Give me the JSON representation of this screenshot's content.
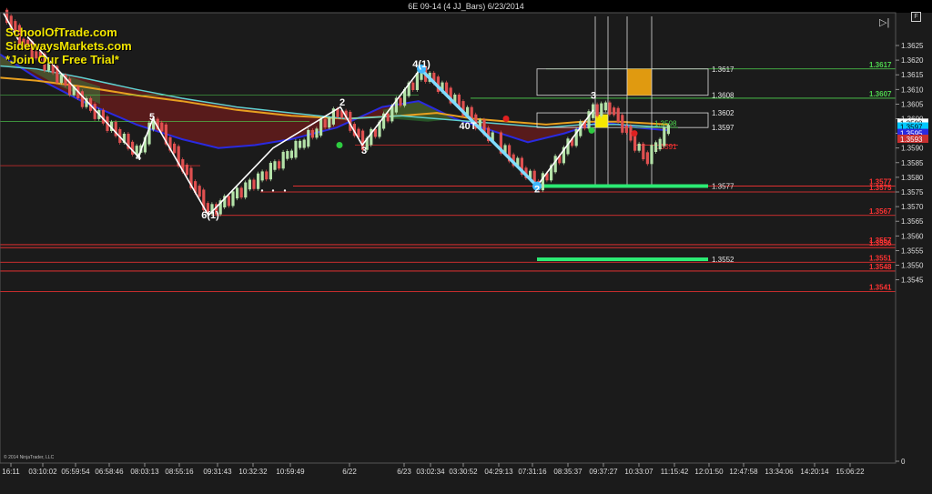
{
  "window": {
    "title": "6E 09-14 (4 JJ_Bars)  6/23/2014",
    "copyright": "© 2014 NinjaTrader, LLC"
  },
  "watermark": {
    "lines": [
      "SchoolOfTrade.com",
      "SidewaysMarkets.com",
      "*Join Our Free Trial*"
    ],
    "color": "#f2e600"
  },
  "icons": {
    "play": "play-end-icon",
    "settings": "f-settings-icon"
  },
  "colors": {
    "background": "#1b1b1b",
    "up_bar": "#b4e2a8",
    "down_bar": "#e05050",
    "zigzag": "#ffffff",
    "leg_highlight": "#7fdcff",
    "support_line": "#2bea73",
    "resistance_line": "#ff3333",
    "target_line": "#4fd64f",
    "orange_box": "#e09a10",
    "yellow_box": "#f5e800"
  },
  "chart_data": {
    "type": "candlestick",
    "symbol": "6E 09-14",
    "bar_type": "4 JJ_Bars",
    "date": "6/23/2014",
    "y_axis": {
      "range": [
        1.3538,
        1.3628
      ],
      "ticks": [
        "1.3625",
        "1.3620",
        "1.3615",
        "1.3610",
        "1.3605",
        "1.3600",
        "1.3595",
        "1.3590",
        "1.3585",
        "1.3580",
        "1.3575",
        "1.3570",
        "1.3565",
        "1.3560",
        "1.3555",
        "1.3550",
        "1.3545",
        "0"
      ],
      "last_price": "1.3598",
      "price_flags": [
        {
          "text": "1.3598",
          "bg": "#ffffff",
          "fg": "#000000"
        },
        {
          "text": "1.3597",
          "bg": "#00c8ff",
          "fg": "#000000"
        },
        {
          "text": "1.3595",
          "bg": "#2a2ae0",
          "fg": "#ffffff"
        },
        {
          "text": "1.3593",
          "bg": "#c83030",
          "fg": "#ffffff"
        }
      ]
    },
    "x_axis_labels": [
      "16:11",
      "03:10:02",
      "05:59:54",
      "06:58:46",
      "08:03:13",
      "08:55:16",
      "09:31:43",
      "10:32:32",
      "10:59:49",
      "6/22",
      "6/23",
      "03:02:34",
      "03:30:52",
      "04:29:13",
      "07:31:16",
      "08:35:37",
      "09:37:27",
      "10:33:07",
      "11:15:42",
      "12:01:50",
      "12:47:58",
      "13:34:06",
      "14:20:14",
      "15:06:22"
    ],
    "swing_labels": [
      {
        "label": "5",
        "price": 1.35995
      },
      {
        "label": "4",
        "price": 1.35858
      },
      {
        "label": "6(1)",
        "price": 1.3566
      },
      {
        "label": "2",
        "price": 1.36045
      },
      {
        "label": "3",
        "price": 1.35881
      },
      {
        "label": "4(1)",
        "price": 1.36175
      },
      {
        "label": "40T",
        "price": 1.35965
      },
      {
        "label": "2",
        "price": 1.35748
      },
      {
        "label": "3",
        "price": 1.36068
      }
    ],
    "horizontal_levels": [
      {
        "text": "1.3617",
        "price": 1.3617,
        "color": "#4fd64f"
      },
      {
        "text": "1.3607",
        "price": 1.3607,
        "color": "#4fd64f"
      },
      {
        "text": "1.3577",
        "price": 1.3577,
        "color": "#ff3333"
      },
      {
        "text": "1.3575",
        "price": 1.3575,
        "color": "#ff3333"
      },
      {
        "text": "1.3567",
        "price": 1.3567,
        "color": "#ff3333"
      },
      {
        "text": "1.3557",
        "price": 1.3557,
        "color": "#ff3333"
      },
      {
        "text": "1.3556",
        "price": 1.3556,
        "color": "#ff3333"
      },
      {
        "text": "1.3551",
        "price": 1.3551,
        "color": "#ff3333"
      },
      {
        "text": "1.3548",
        "price": 1.3548,
        "color": "#ff3333"
      },
      {
        "text": "1.3541",
        "price": 1.3541,
        "color": "#ff3333"
      }
    ],
    "box_labels": [
      {
        "text": "1.3617",
        "price": 1.3617
      },
      {
        "text": "1.3608",
        "price": 1.3608
      },
      {
        "text": "1.3602",
        "price": 1.3602
      },
      {
        "text": "1.3597",
        "price": 1.3597
      },
      {
        "text": "1.3577",
        "price": 1.3577
      },
      {
        "text": "1.3552",
        "price": 1.3552
      }
    ],
    "marker_labels": [
      {
        "text": "1.3598",
        "price": 1.35985,
        "color": "#4fd64f"
      },
      {
        "text": "1.3591",
        "price": 1.35905,
        "color": "#ff3333"
      }
    ],
    "grid": false,
    "legend": "none"
  }
}
